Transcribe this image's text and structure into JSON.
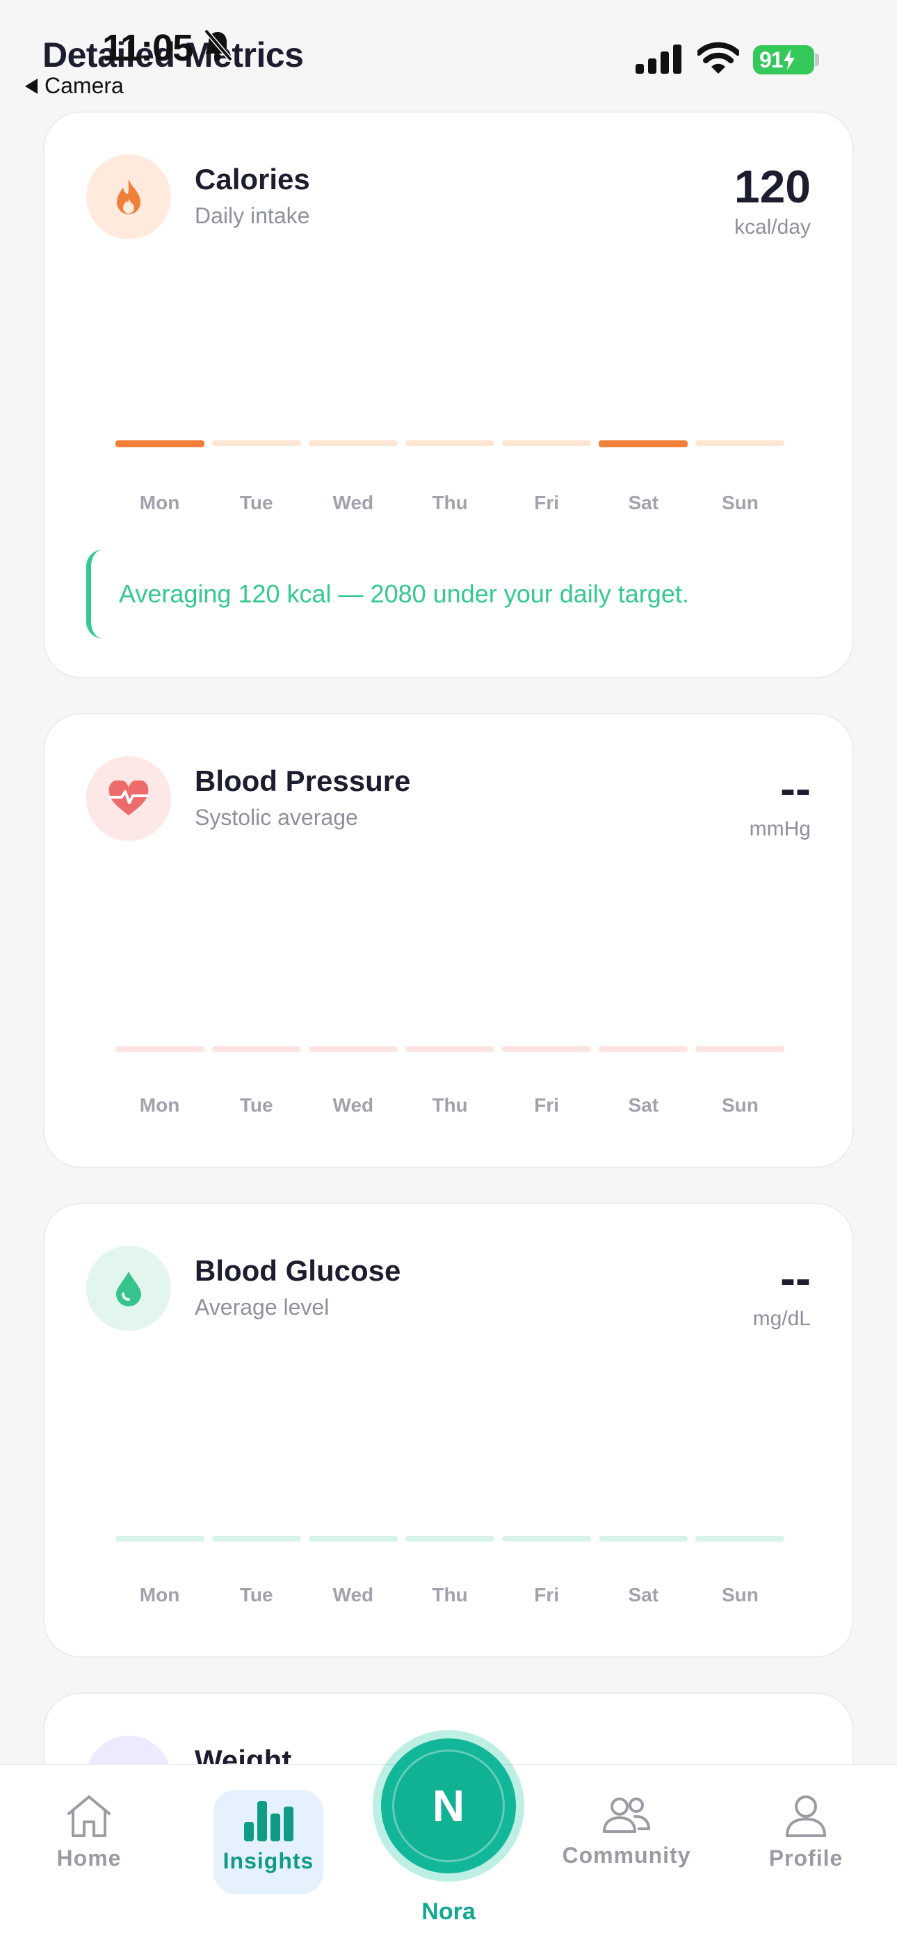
{
  "status": {
    "time": "11:05",
    "back_label": "Camera",
    "battery": "91"
  },
  "header": {
    "title": "Detailed Metrics"
  },
  "days": [
    "Mon",
    "Tue",
    "Wed",
    "Thu",
    "Fri",
    "Sat",
    "Sun"
  ],
  "cards": [
    {
      "title": "Calories",
      "subtitle": "Daily intake",
      "value": "120",
      "unit": "kcal/day",
      "icon": "flame-icon",
      "accent": "#f07f3a",
      "icon_bg": "#ffeadd",
      "bar_idle": "#fde5d3",
      "filled_days": [
        "Mon",
        "Sat"
      ],
      "insight": "Averaging 120 kcal — 2080 under your daily target."
    },
    {
      "title": "Blood Pressure",
      "subtitle": "Systolic average",
      "value": "--",
      "unit": "mmHg",
      "icon": "heart-pulse-icon",
      "accent": "#ee6b6b",
      "icon_bg": "#fde8e8",
      "bar_idle": "#fde4e2",
      "filled_days": []
    },
    {
      "title": "Blood Glucose",
      "subtitle": "Average level",
      "value": "--",
      "unit": "mg/dL",
      "icon": "droplet-icon",
      "accent": "#36c48c",
      "icon_bg": "#e3f6ee",
      "bar_idle": "#d8f3ea",
      "filled_days": []
    },
    {
      "title": "Weight",
      "icon": "weight-icon",
      "accent": "#9b7cf2",
      "icon_bg": "#efe9fd"
    }
  ],
  "nav": {
    "home": "Home",
    "insights": "Insights",
    "nora": "Nora",
    "nora_initial": "N",
    "community": "Community",
    "profile": "Profile",
    "active": "insights",
    "active_color": "#109b86"
  }
}
